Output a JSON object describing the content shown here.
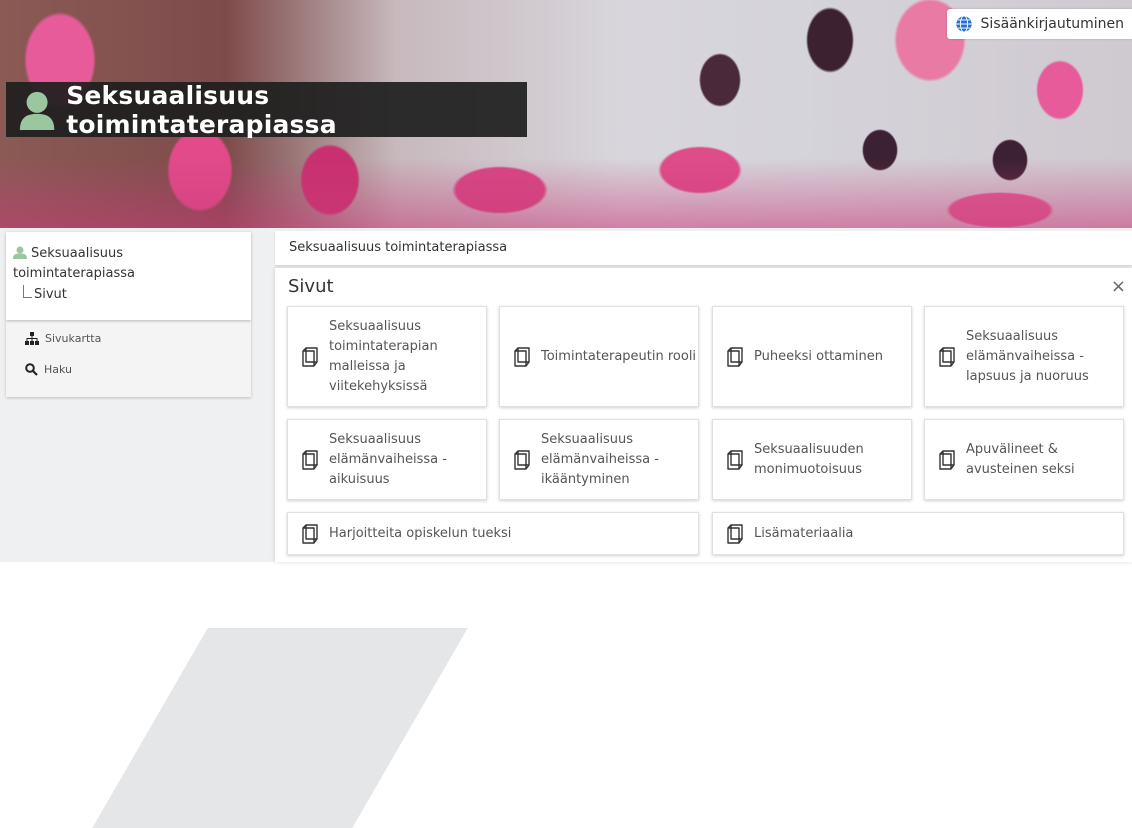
{
  "header": {
    "login_label": "Sisäänkirjautuminen",
    "site_title": "Seksuaalisuus toimintaterapiassa"
  },
  "sidebar": {
    "root_label": "Seksuaalisuus toimintaterapiassa",
    "child_label": "Sivut",
    "tools": [
      {
        "label": "Sivukartta",
        "icon": "sitemap-icon"
      },
      {
        "label": "Haku",
        "icon": "search-icon"
      }
    ]
  },
  "breadcrumb": "Seksuaalisuus toimintaterapiassa",
  "panel": {
    "title": "Sivut",
    "close_glyph": "×",
    "cards": [
      {
        "label": "Seksuaalisuus toimintaterapian malleissa ja viitekehyksissä"
      },
      {
        "label": "Toimintaterapeutin rooli"
      },
      {
        "label": "Puheeksi ottaminen"
      },
      {
        "label": "Seksuaalisuus elämänvaiheissa - lapsuus ja nuoruus"
      },
      {
        "label": "Seksuaalisuus elämänvaiheissa - aikuisuus"
      },
      {
        "label": "Seksuaalisuus elämänvaiheissa - ikääntyminen"
      },
      {
        "label": "Seksuaalisuuden monimuotoisuus"
      },
      {
        "label": "Apuvälineet & avusteinen seksi"
      },
      {
        "label": "Harjoitteita opiskelun tueksi"
      },
      {
        "label": "Lisämateriaalia"
      }
    ]
  },
  "colors": {
    "accent_icon": "#3a7bd5",
    "title_bg": "#1e1e1e",
    "user_icon": "#9bc7a0"
  }
}
